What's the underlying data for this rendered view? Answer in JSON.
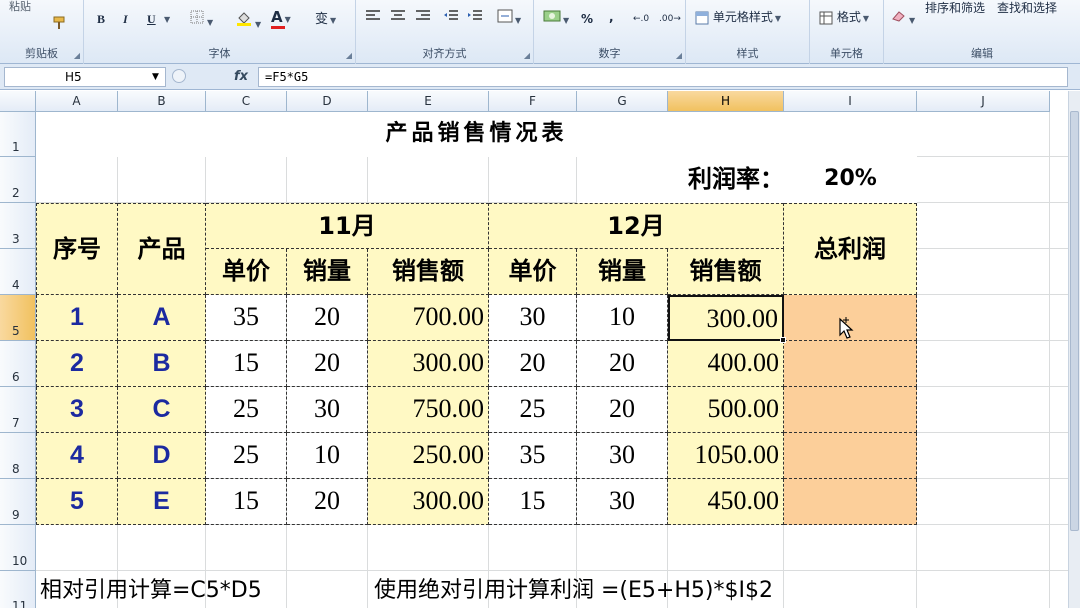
{
  "ribbon": {
    "clipboard": {
      "paste": "粘贴",
      "label": "剪贴板"
    },
    "font": {
      "bold": "B",
      "italic": "I",
      "underline": "U",
      "label": "字体"
    },
    "alignment": {
      "label": "对齐方式"
    },
    "number": {
      "percent": "%",
      "comma": ",",
      "label": "数字"
    },
    "styles": {
      "cell_styles": "单元格样式",
      "label": "样式"
    },
    "cells": {
      "format": "格式",
      "label": "单元格"
    },
    "editing": {
      "sort_filter": "排序和筛选",
      "find_select": "查找和选择",
      "label": "编辑"
    }
  },
  "formula_bar": {
    "name_box": "H5",
    "fx": "fx",
    "formula": "=F5*G5"
  },
  "columns": [
    "A",
    "B",
    "C",
    "D",
    "E",
    "F",
    "G",
    "H",
    "I",
    "J"
  ],
  "selected_column": "H",
  "rows": [
    "1",
    "2",
    "3",
    "4",
    "5",
    "6",
    "7",
    "8",
    "9",
    "10",
    "11"
  ],
  "selected_row": "5",
  "sheet": {
    "title": "产品销售情况表",
    "profit_rate_label": "利润率：",
    "profit_rate_value": "20%",
    "seq_header": "序号",
    "product_header": "产品",
    "month1": "11月",
    "month2": "12月",
    "total_profit_header": "总利润",
    "sub_headers": [
      "单价",
      "销量",
      "销售额",
      "单价",
      "销量",
      "销售额"
    ],
    "data": [
      {
        "seq": "1",
        "product": "A",
        "p1": "35",
        "q1": "20",
        "s1": "700.00",
        "p2": "30",
        "q2": "10",
        "s2": "300.00"
      },
      {
        "seq": "2",
        "product": "B",
        "p1": "15",
        "q1": "20",
        "s1": "300.00",
        "p2": "20",
        "q2": "20",
        "s2": "400.00"
      },
      {
        "seq": "3",
        "product": "C",
        "p1": "25",
        "q1": "30",
        "s1": "750.00",
        "p2": "25",
        "q2": "20",
        "s2": "500.00"
      },
      {
        "seq": "4",
        "product": "D",
        "p1": "25",
        "q1": "10",
        "s1": "250.00",
        "p2": "35",
        "q2": "30",
        "s2": "1050.00"
      },
      {
        "seq": "5",
        "product": "E",
        "p1": "15",
        "q1": "20",
        "s1": "300.00",
        "p2": "15",
        "q2": "30",
        "s2": "450.00"
      }
    ],
    "note_relative": "相对引用计算=C5*D5",
    "note_absolute": "使用绝对引用计算利润 =(E5+H5)*$I$2"
  },
  "colors": {
    "header_fill": "#fff9c4",
    "total_fill": "#fccf9a",
    "index_text": "#1c2aa0"
  }
}
